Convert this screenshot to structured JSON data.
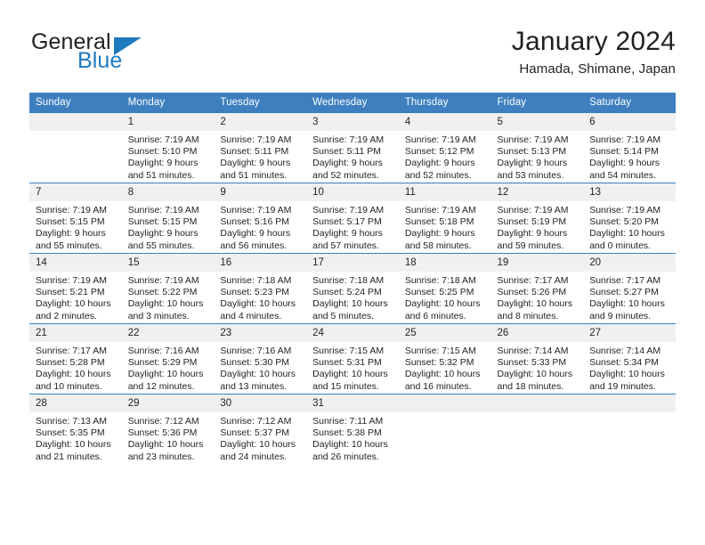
{
  "brand": {
    "name_top": "General",
    "name_bottom": "Blue",
    "colors": {
      "dark": "#221f1f",
      "blue": "#1f7ac0"
    }
  },
  "header": {
    "title": "January 2024",
    "subtitle": "Hamada, Shimane, Japan"
  },
  "theme": {
    "header_bg": "#3d7fbf",
    "daynum_bg": "#f0f0f0",
    "text": "#231f20"
  },
  "weekdays": [
    "Sunday",
    "Monday",
    "Tuesday",
    "Wednesday",
    "Thursday",
    "Friday",
    "Saturday"
  ],
  "weeks": [
    [
      {
        "day": "",
        "lines": []
      },
      {
        "day": "1",
        "lines": [
          "Sunrise: 7:19 AM",
          "Sunset: 5:10 PM",
          "Daylight: 9 hours",
          "and 51 minutes."
        ]
      },
      {
        "day": "2",
        "lines": [
          "Sunrise: 7:19 AM",
          "Sunset: 5:11 PM",
          "Daylight: 9 hours",
          "and 51 minutes."
        ]
      },
      {
        "day": "3",
        "lines": [
          "Sunrise: 7:19 AM",
          "Sunset: 5:11 PM",
          "Daylight: 9 hours",
          "and 52 minutes."
        ]
      },
      {
        "day": "4",
        "lines": [
          "Sunrise: 7:19 AM",
          "Sunset: 5:12 PM",
          "Daylight: 9 hours",
          "and 52 minutes."
        ]
      },
      {
        "day": "5",
        "lines": [
          "Sunrise: 7:19 AM",
          "Sunset: 5:13 PM",
          "Daylight: 9 hours",
          "and 53 minutes."
        ]
      },
      {
        "day": "6",
        "lines": [
          "Sunrise: 7:19 AM",
          "Sunset: 5:14 PM",
          "Daylight: 9 hours",
          "and 54 minutes."
        ]
      }
    ],
    [
      {
        "day": "7",
        "lines": [
          "Sunrise: 7:19 AM",
          "Sunset: 5:15 PM",
          "Daylight: 9 hours",
          "and 55 minutes."
        ]
      },
      {
        "day": "8",
        "lines": [
          "Sunrise: 7:19 AM",
          "Sunset: 5:15 PM",
          "Daylight: 9 hours",
          "and 55 minutes."
        ]
      },
      {
        "day": "9",
        "lines": [
          "Sunrise: 7:19 AM",
          "Sunset: 5:16 PM",
          "Daylight: 9 hours",
          "and 56 minutes."
        ]
      },
      {
        "day": "10",
        "lines": [
          "Sunrise: 7:19 AM",
          "Sunset: 5:17 PM",
          "Daylight: 9 hours",
          "and 57 minutes."
        ]
      },
      {
        "day": "11",
        "lines": [
          "Sunrise: 7:19 AM",
          "Sunset: 5:18 PM",
          "Daylight: 9 hours",
          "and 58 minutes."
        ]
      },
      {
        "day": "12",
        "lines": [
          "Sunrise: 7:19 AM",
          "Sunset: 5:19 PM",
          "Daylight: 9 hours",
          "and 59 minutes."
        ]
      },
      {
        "day": "13",
        "lines": [
          "Sunrise: 7:19 AM",
          "Sunset: 5:20 PM",
          "Daylight: 10 hours",
          "and 0 minutes."
        ]
      }
    ],
    [
      {
        "day": "14",
        "lines": [
          "Sunrise: 7:19 AM",
          "Sunset: 5:21 PM",
          "Daylight: 10 hours",
          "and 2 minutes."
        ]
      },
      {
        "day": "15",
        "lines": [
          "Sunrise: 7:19 AM",
          "Sunset: 5:22 PM",
          "Daylight: 10 hours",
          "and 3 minutes."
        ]
      },
      {
        "day": "16",
        "lines": [
          "Sunrise: 7:18 AM",
          "Sunset: 5:23 PM",
          "Daylight: 10 hours",
          "and 4 minutes."
        ]
      },
      {
        "day": "17",
        "lines": [
          "Sunrise: 7:18 AM",
          "Sunset: 5:24 PM",
          "Daylight: 10 hours",
          "and 5 minutes."
        ]
      },
      {
        "day": "18",
        "lines": [
          "Sunrise: 7:18 AM",
          "Sunset: 5:25 PM",
          "Daylight: 10 hours",
          "and 6 minutes."
        ]
      },
      {
        "day": "19",
        "lines": [
          "Sunrise: 7:17 AM",
          "Sunset: 5:26 PM",
          "Daylight: 10 hours",
          "and 8 minutes."
        ]
      },
      {
        "day": "20",
        "lines": [
          "Sunrise: 7:17 AM",
          "Sunset: 5:27 PM",
          "Daylight: 10 hours",
          "and 9 minutes."
        ]
      }
    ],
    [
      {
        "day": "21",
        "lines": [
          "Sunrise: 7:17 AM",
          "Sunset: 5:28 PM",
          "Daylight: 10 hours",
          "and 10 minutes."
        ]
      },
      {
        "day": "22",
        "lines": [
          "Sunrise: 7:16 AM",
          "Sunset: 5:29 PM",
          "Daylight: 10 hours",
          "and 12 minutes."
        ]
      },
      {
        "day": "23",
        "lines": [
          "Sunrise: 7:16 AM",
          "Sunset: 5:30 PM",
          "Daylight: 10 hours",
          "and 13 minutes."
        ]
      },
      {
        "day": "24",
        "lines": [
          "Sunrise: 7:15 AM",
          "Sunset: 5:31 PM",
          "Daylight: 10 hours",
          "and 15 minutes."
        ]
      },
      {
        "day": "25",
        "lines": [
          "Sunrise: 7:15 AM",
          "Sunset: 5:32 PM",
          "Daylight: 10 hours",
          "and 16 minutes."
        ]
      },
      {
        "day": "26",
        "lines": [
          "Sunrise: 7:14 AM",
          "Sunset: 5:33 PM",
          "Daylight: 10 hours",
          "and 18 minutes."
        ]
      },
      {
        "day": "27",
        "lines": [
          "Sunrise: 7:14 AM",
          "Sunset: 5:34 PM",
          "Daylight: 10 hours",
          "and 19 minutes."
        ]
      }
    ],
    [
      {
        "day": "28",
        "lines": [
          "Sunrise: 7:13 AM",
          "Sunset: 5:35 PM",
          "Daylight: 10 hours",
          "and 21 minutes."
        ]
      },
      {
        "day": "29",
        "lines": [
          "Sunrise: 7:12 AM",
          "Sunset: 5:36 PM",
          "Daylight: 10 hours",
          "and 23 minutes."
        ]
      },
      {
        "day": "30",
        "lines": [
          "Sunrise: 7:12 AM",
          "Sunset: 5:37 PM",
          "Daylight: 10 hours",
          "and 24 minutes."
        ]
      },
      {
        "day": "31",
        "lines": [
          "Sunrise: 7:11 AM",
          "Sunset: 5:38 PM",
          "Daylight: 10 hours",
          "and 26 minutes."
        ]
      },
      {
        "day": "",
        "lines": []
      },
      {
        "day": "",
        "lines": []
      },
      {
        "day": "",
        "lines": []
      }
    ]
  ]
}
